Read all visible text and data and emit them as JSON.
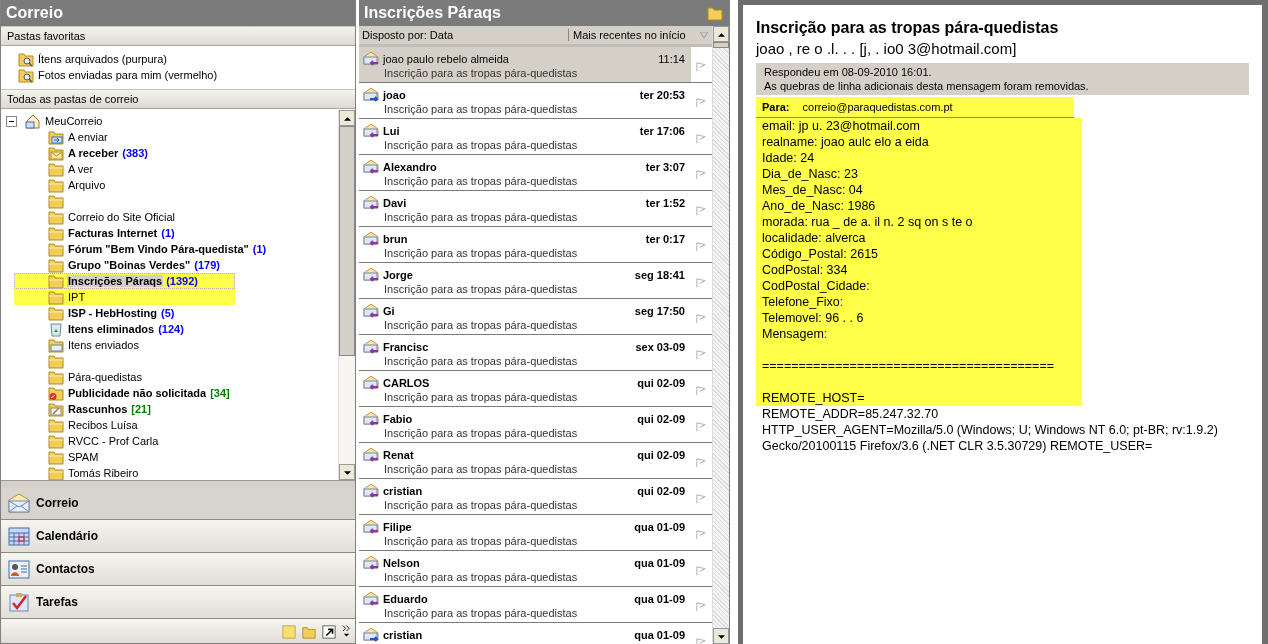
{
  "left_pane": {
    "title": "Correio",
    "favorites_header": "Pastas favoritas",
    "favorites": [
      {
        "label": "Ítens arquivados (purpura)"
      },
      {
        "label": "Fotos enviadas para mim (vermelho)"
      }
    ],
    "all_folders_header": "Todas as pastas de correio",
    "tree": {
      "label": "MeuCorreio",
      "expanded": true,
      "children": [
        {
          "label": "A enviar",
          "bold": false,
          "kind": "outbox",
          "selected": false
        },
        {
          "label": "A receber",
          "bold": true,
          "count": "(383)",
          "count_unread": true,
          "kind": "inbox",
          "selected": false
        },
        {
          "label": "A ver",
          "bold": false,
          "kind": "folder",
          "selected": false
        },
        {
          "label": "Arquivo",
          "bold": false,
          "kind": "folder",
          "selected": false
        },
        {
          "bold": false,
          "kind": "folder",
          "selected": false
        },
        {
          "label": "Correio do Site Oficial",
          "bold": false,
          "kind": "folder",
          "selected": false
        },
        {
          "label": "Facturas Internet",
          "bold": true,
          "count": "(1)",
          "count_unread": true,
          "kind": "folder",
          "selected": false
        },
        {
          "label": "Fórum \"Bem Vindo Pára-quedista\"",
          "bold": true,
          "count": "(1)",
          "count_unread": true,
          "kind": "folder",
          "selected": false
        },
        {
          "label": "Grupo \"Boinas Verdes\"",
          "bold": true,
          "count": "(179)",
          "count_unread": true,
          "kind": "folder",
          "selected": false
        },
        {
          "label": "Inscrições Páraqs",
          "bold": true,
          "count": "(1392)",
          "count_unread": true,
          "kind": "folder",
          "selected": true,
          "highlighted": true
        },
        {
          "label": "IPT",
          "bold": false,
          "kind": "folder",
          "selected": false,
          "highlighted": true
        },
        {
          "label": "ISP - HebHosting",
          "bold": true,
          "count": "(5)",
          "count_unread": true,
          "kind": "folder",
          "selected": false
        },
        {
          "label": "Itens eliminados",
          "bold": true,
          "count": "(124)",
          "count_unread": true,
          "kind": "trash",
          "selected": false
        },
        {
          "label": "Itens enviados",
          "bold": false,
          "kind": "sent",
          "selected": false
        },
        {
          "bold": false,
          "kind": "folder",
          "selected": false
        },
        {
          "label": "Pára-quedistas",
          "bold": false,
          "kind": "folder",
          "selected": false
        },
        {
          "label": "Publicidade não solicitada",
          "bold": true,
          "count": "[34]",
          "count_unread": false,
          "kind": "junk",
          "selected": false
        },
        {
          "label": "Rascunhos",
          "bold": true,
          "count": "[21]",
          "count_unread": false,
          "kind": "drafts",
          "selected": false
        },
        {
          "label": "Recibos Luísa",
          "bold": false,
          "kind": "folder",
          "selected": false
        },
        {
          "label": "RVCC - Prof Carla",
          "bold": false,
          "kind": "folder",
          "selected": false
        },
        {
          "label": "SPAM",
          "bold": false,
          "kind": "folder",
          "selected": false
        },
        {
          "label": "Tomás Ribeiro",
          "bold": false,
          "kind": "folder",
          "selected": false
        }
      ]
    },
    "nav": [
      {
        "label": "Correio",
        "kind": "mail",
        "selected": true
      },
      {
        "label": "Calendário",
        "kind": "calendar",
        "selected": false
      },
      {
        "label": "Contactos",
        "kind": "contacts",
        "selected": false
      },
      {
        "label": "Tarefas",
        "kind": "tasks",
        "selected": false
      }
    ]
  },
  "message_list": {
    "title": "Inscrições Páraqs",
    "sort_by": "Disposto por: Data",
    "order": "Mais recentes no início",
    "messages": [
      {
        "sender": "joao paulo rebelo almeida",
        "subject": "Inscrição para as tropas pára-quedistas",
        "time": "11:14",
        "unread": false,
        "selected": true,
        "kind": "replied"
      },
      {
        "sender": "joao",
        "subject": "Inscrição para as tropas pára-quedistas",
        "time": "ter 20:53",
        "unread": true,
        "selected": false,
        "kind": "forwarded"
      },
      {
        "sender": "Lui",
        "subject": "Inscrição para as tropas pára-quedistas",
        "time": "ter 17:06",
        "unread": true,
        "selected": false,
        "kind": "replied"
      },
      {
        "sender": "Alexandro",
        "subject": "Inscrição para as tropas pára-quedistas",
        "time": "ter 3:07",
        "unread": true,
        "selected": false,
        "kind": "replied"
      },
      {
        "sender": "Davi",
        "subject": "Inscrição para as tropas pára-quedistas",
        "time": "ter 1:52",
        "unread": true,
        "selected": false,
        "kind": "replied"
      },
      {
        "sender": "brun",
        "subject": "Inscrição para as tropas pára-quedistas",
        "time": "ter 0:17",
        "unread": true,
        "selected": false,
        "kind": "replied"
      },
      {
        "sender": "Jorge",
        "subject": "Inscrição para as tropas pára-quedistas",
        "time": "seg 18:41",
        "unread": true,
        "selected": false,
        "kind": "replied"
      },
      {
        "sender": "Gi",
        "subject": "Inscrição para as tropas pára-quedistas",
        "time": "seg 17:50",
        "unread": true,
        "selected": false,
        "kind": "replied"
      },
      {
        "sender": "Francisc",
        "subject": "Inscrição para as tropas pára-quedistas",
        "time": "sex 03-09",
        "unread": true,
        "selected": false,
        "kind": "replied"
      },
      {
        "sender": "CARLOS",
        "subject": "Inscrição para as tropas pára-quedistas",
        "time": "qui 02-09",
        "unread": true,
        "selected": false,
        "kind": "replied"
      },
      {
        "sender": "Fabio",
        "subject": "Inscrição para as tropas pára-quedistas",
        "time": "qui 02-09",
        "unread": true,
        "selected": false,
        "kind": "replied"
      },
      {
        "sender": "Renat",
        "subject": "Inscrição para as tropas pára-quedistas",
        "time": "qui 02-09",
        "unread": true,
        "selected": false,
        "kind": "replied"
      },
      {
        "sender": "cristian",
        "subject": "Inscrição para as tropas pára-quedistas",
        "time": "qui 02-09",
        "unread": true,
        "selected": false,
        "kind": "replied"
      },
      {
        "sender": "Filipe",
        "subject": "Inscrição para as tropas pára-quedistas",
        "time": "qua 01-09",
        "unread": true,
        "selected": false,
        "kind": "replied"
      },
      {
        "sender": "Nelson",
        "subject": "Inscrição para as tropas pára-quedistas",
        "time": "qua 01-09",
        "unread": true,
        "selected": false,
        "kind": "replied"
      },
      {
        "sender": "Eduardo",
        "subject": "Inscrição para as tropas pára-quedistas",
        "time": "qua 01-09",
        "unread": true,
        "selected": false,
        "kind": "replied"
      },
      {
        "sender": "cristian",
        "time": "qua 01-09",
        "unread": true,
        "selected": false,
        "kind": "forwarded"
      }
    ]
  },
  "reading_pane": {
    "subject": "Inscrição para as tropas pára-quedistas",
    "from": "joao ,     re   o .l.  .   . [j,  .  io0  3@hotmail.com]",
    "info": [
      "Respondeu em 08-09-2010 16:01.",
      "As quebras de linha adicionais desta mensagem foram removidas."
    ],
    "to_label": "Para:",
    "to": "correio@paraquedistas.com.pt",
    "to_highlighted": true,
    "body": [
      {
        "kind": "text",
        "text": "email: jp   u.    23@hotmail.com",
        "highlighted": true
      },
      {
        "kind": "text",
        "text": "realname: joao  aulc     elo a  eida",
        "highlighted": true
      },
      {
        "kind": "text",
        "text": "Idade: 24",
        "highlighted": true
      },
      {
        "kind": "text",
        "text": "Dia_de_Nasc: 23",
        "highlighted": true
      },
      {
        "kind": "text",
        "text": "Mes_de_Nasc: 04",
        "highlighted": true
      },
      {
        "kind": "text",
        "text": "Ano_de_Nasc: 1986",
        "highlighted": true
      },
      {
        "kind": "text",
        "text": "morada: rua  _  de a.  il n.   2  sq  on s  te  o",
        "highlighted": true
      },
      {
        "kind": "text",
        "text": "localidade: alverca",
        "highlighted": true
      },
      {
        "kind": "text",
        "text": "Código_Postal: 2615",
        "highlighted": true
      },
      {
        "kind": "text",
        "text": "CodPostal: 334",
        "highlighted": true
      },
      {
        "kind": "text",
        "text": "CodPostal_Cidade:",
        "highlighted": true
      },
      {
        "kind": "text",
        "text": "Telefone_Fixo:",
        "highlighted": true
      },
      {
        "kind": "text",
        "text": "Telemovel: 96   .   .  6",
        "highlighted": true
      },
      {
        "kind": "text",
        "text": "Mensagem:",
        "highlighted": true
      },
      {
        "kind": "gap",
        "highlighted": true
      },
      {
        "kind": "text",
        "text": "========================================",
        "highlighted": true
      },
      {
        "kind": "gap",
        "highlighted": true
      },
      {
        "kind": "text",
        "text": "REMOTE_HOST=",
        "highlighted": true
      },
      {
        "kind": "text",
        "text": "REMOTE_ADDR=85.247.32.70",
        "highlighted": false
      },
      {
        "kind": "text",
        "text": "HTTP_USER_AGENT=Mozilla/5.0 (Windows; U; Windows NT 6.0; pt-BR; rv:1.9.2)",
        "highlighted": false
      },
      {
        "kind": "text",
        "text": "Gecko/20100115 Firefox/3.6 (.NET CLR 3.5.30729) REMOTE_USER=",
        "highlighted": false
      }
    ]
  }
}
